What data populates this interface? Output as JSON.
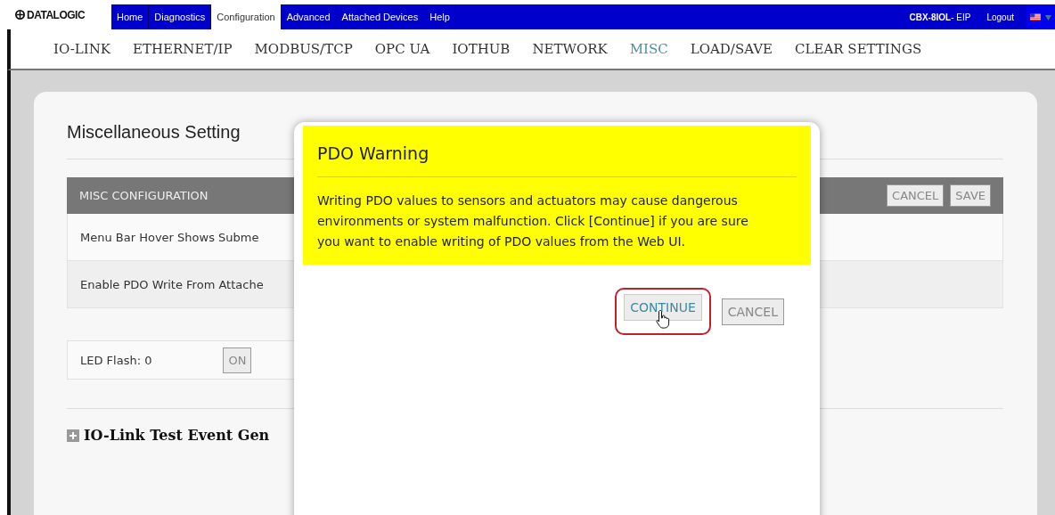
{
  "logo": "DATALOGIC",
  "menu": [
    {
      "label": "Home",
      "selected": false
    },
    {
      "label": "Diagnostics",
      "selected": false
    },
    {
      "label": "Configuration",
      "selected": true
    },
    {
      "label": "Advanced",
      "selected": false
    },
    {
      "label": "Attached Devices",
      "selected": false
    },
    {
      "label": "Help",
      "selected": false
    }
  ],
  "device": {
    "model": "CBX-8IOL",
    "suffix": "- EIP"
  },
  "logout": "Logout",
  "subnav": [
    {
      "label": "IO-LINK",
      "selected": false
    },
    {
      "label": "ETHERNET/IP",
      "selected": false
    },
    {
      "label": "MODBUS/TCP",
      "selected": false
    },
    {
      "label": "OPC UA",
      "selected": false
    },
    {
      "label": "IOTHUB",
      "selected": false
    },
    {
      "label": "NETWORK",
      "selected": false
    },
    {
      "label": "MISC",
      "selected": true
    },
    {
      "label": "LOAD/SAVE",
      "selected": false
    },
    {
      "label": "CLEAR SETTINGS",
      "selected": false
    }
  ],
  "page": {
    "title": "Miscellaneous Setting",
    "table": {
      "header": "MISC CONFIGURATION",
      "buttons": [
        "CANCEL",
        "SAVE"
      ],
      "rows": [
        "Menu Bar Hover Shows Subme",
        "Enable PDO Write From Attache"
      ]
    },
    "led": {
      "label": "LED Flash: 0",
      "button": "ON"
    },
    "section": {
      "label": "IO-Link Test Event Gen",
      "expanded": false
    }
  },
  "dialog": {
    "title": "PDO Warning",
    "message": "Writing PDO values to sensors and actuators may cause dangerous environments or system malfunction. Click [Continue] if you are sure you want to enable writing of PDO values from the Web UI.",
    "buttons": [
      {
        "label": "CONTINUE",
        "highlighted": true
      },
      {
        "label": "CANCEL",
        "highlighted": false
      }
    ]
  }
}
